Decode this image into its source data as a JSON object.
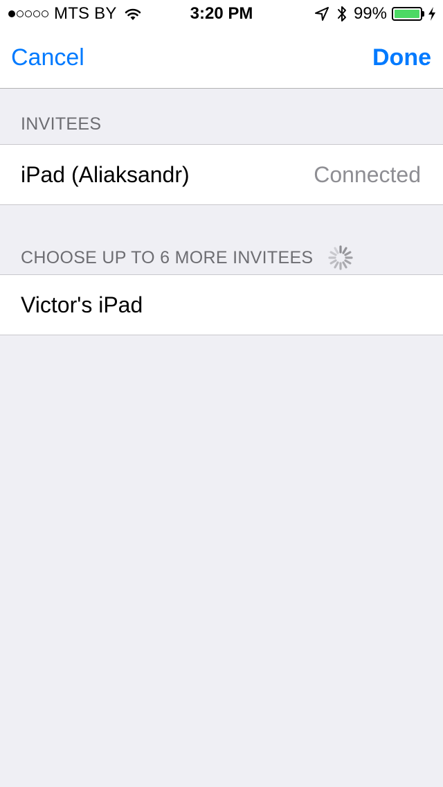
{
  "status_bar": {
    "carrier": "MTS BY",
    "time": "3:20 PM",
    "battery_percent_label": "99%",
    "battery_level": 0.99,
    "signal_bars_filled": 1,
    "signal_bars_total": 5,
    "icons": [
      "wifi-icon",
      "location-arrow-icon",
      "bluetooth-icon",
      "battery-icon",
      "charging-bolt-icon"
    ]
  },
  "nav": {
    "cancel_label": "Cancel",
    "done_label": "Done"
  },
  "sections": {
    "invitees": {
      "header": "INVITEES",
      "rows": [
        {
          "title": "iPad (Aliaksandr)",
          "detail": "Connected"
        }
      ]
    },
    "more_invitees": {
      "header": "CHOOSE UP TO 6 MORE INVITEES",
      "rows": [
        {
          "title": "Victor's iPad"
        }
      ]
    }
  },
  "colors": {
    "tint": "#007aff",
    "background": "#efeff4",
    "header_text": "#6d6d72",
    "detail_text": "#8e8e93",
    "battery_fill": "#4cd964"
  }
}
